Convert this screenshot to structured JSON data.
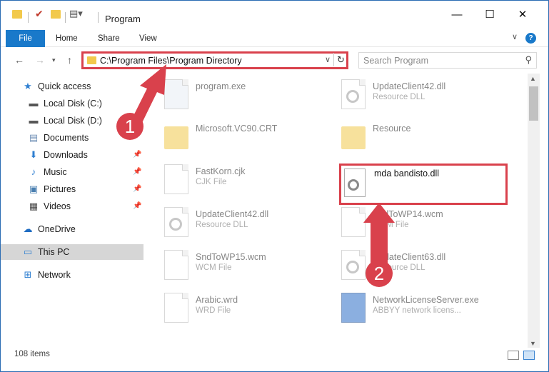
{
  "window": {
    "title": "Program",
    "controls": {
      "minimize": "—",
      "maximize": "☐",
      "close": "✕"
    }
  },
  "ribbon": {
    "tabs": [
      "File",
      "Home",
      "Share",
      "View"
    ],
    "expand_glyph": "∨",
    "help_glyph": "?"
  },
  "address": {
    "path": "C:\\Program Files\\Program Directory",
    "refresh_glyph": "↻"
  },
  "search": {
    "placeholder": "Search Program",
    "icon": "search-icon"
  },
  "navpane": {
    "quick_access": "Quick access",
    "items": [
      {
        "label": "Local Disk (C:)",
        "icon": "drive-icon"
      },
      {
        "label": "Local Disk (D:)",
        "icon": "drive-icon"
      },
      {
        "label": "Documents",
        "icon": "documents-icon"
      },
      {
        "label": "Downloads",
        "icon": "download-icon"
      },
      {
        "label": "Music",
        "icon": "music-icon"
      },
      {
        "label": "Pictures",
        "icon": "pictures-icon"
      },
      {
        "label": "Videos",
        "icon": "videos-icon"
      }
    ],
    "onedrive": "OneDrive",
    "this_pc": "This PC",
    "network": "Network"
  },
  "files": [
    {
      "name": "program.exe",
      "type": "",
      "kind": "app"
    },
    {
      "name": "UpdateClient42.dll",
      "type": "Resource DLL",
      "kind": "dll"
    },
    {
      "name": "Microsoft.VC90.CRT",
      "type": "",
      "kind": "folder"
    },
    {
      "name": "Resource",
      "type": "",
      "kind": "folder"
    },
    {
      "name": "FastKorn.cjk",
      "type": "CJK File",
      "kind": "doc"
    },
    {
      "name": "UpdateClient42.dll",
      "type": "Resource DLL",
      "kind": "dll"
    },
    {
      "name": "SndToWP14.wcm",
      "type": "WCM File",
      "kind": "doc"
    },
    {
      "name": "SndToWP15.wcm",
      "type": "WCM File",
      "kind": "doc"
    },
    {
      "name": "UpdateClient63.dll",
      "type": "Resource DLL",
      "kind": "dll"
    },
    {
      "name": "Arabic.wrd",
      "type": "WRD File",
      "kind": "doc"
    },
    {
      "name": "NetworkLicenseServer.exe",
      "type": "ABBYY network licens...",
      "kind": "exe"
    }
  ],
  "highlighted_file": {
    "name": "mda bandisto.dll"
  },
  "annotations": {
    "badge1": "1",
    "badge2": "2",
    "accent": "#d9414c"
  },
  "status": {
    "count": "108 items"
  }
}
